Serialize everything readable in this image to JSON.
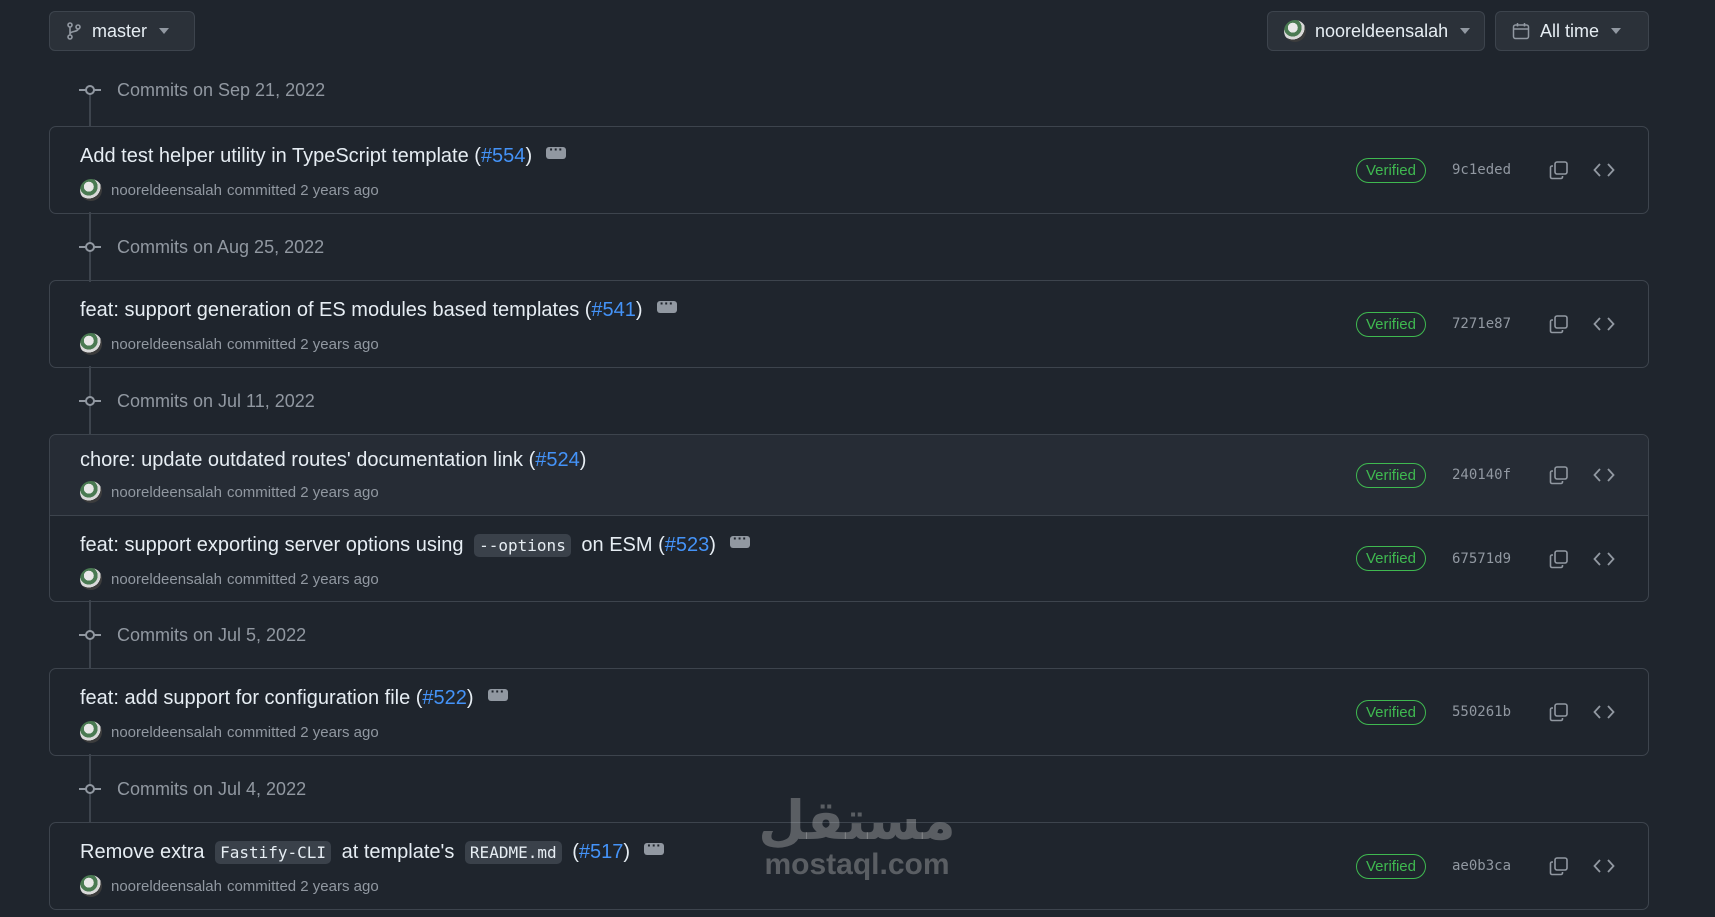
{
  "toolbar": {
    "branch": "master",
    "author": "nooreldeensalah",
    "time_filter": "All time"
  },
  "groups": [
    {
      "date": "Commits on Sep 21, 2022",
      "commits": [
        {
          "title": "Add test helper utility in TypeScript template (",
          "pr": "#554",
          "after": ")",
          "author": "nooreldeensalah",
          "action": "committed",
          "when": "2 years ago",
          "status": "Verified",
          "sha": "9c1eded"
        }
      ]
    },
    {
      "date": "Commits on Aug 25, 2022",
      "commits": [
        {
          "title": "feat: support generation of ES modules based templates (",
          "pr": "#541",
          "after": ")",
          "author": "nooreldeensalah",
          "action": "committed",
          "when": "2 years ago",
          "status": "Verified",
          "sha": "7271e87"
        }
      ]
    },
    {
      "date": "Commits on Jul 11, 2022",
      "commits": [
        {
          "title": "chore: update outdated routes' documentation link (",
          "pr": "#524",
          "after": ")",
          "author": "nooreldeensalah",
          "action": "committed",
          "when": "2 years ago",
          "status": "Verified",
          "sha": "240140f"
        },
        {
          "title_a": "feat: support exporting server options using",
          "code": "--options",
          "title_b": "on ESM (",
          "pr": "#523",
          "after": ")",
          "author": "nooreldeensalah",
          "action": "committed",
          "when": "2 years ago",
          "status": "Verified",
          "sha": "67571d9"
        }
      ]
    },
    {
      "date": "Commits on Jul 5, 2022",
      "commits": [
        {
          "title": "feat: add support for configuration file (",
          "pr": "#522",
          "after": ")",
          "author": "nooreldeensalah",
          "action": "committed",
          "when": "2 years ago",
          "status": "Verified",
          "sha": "550261b"
        }
      ]
    },
    {
      "date": "Commits on Jul 4, 2022",
      "commits": [
        {
          "title_a": "Remove extra",
          "code": "Fastify-CLI",
          "title_b": "at template's",
          "code2": "README.md",
          "title_c": "(",
          "pr": "#517",
          "after": ")",
          "author": "nooreldeensalah",
          "action": "committed",
          "when": "2 years ago",
          "status": "Verified",
          "sha": "ae0b3ca"
        }
      ]
    }
  ],
  "watermark": {
    "arabic": "مستقل",
    "latin": "mostaql.com"
  }
}
